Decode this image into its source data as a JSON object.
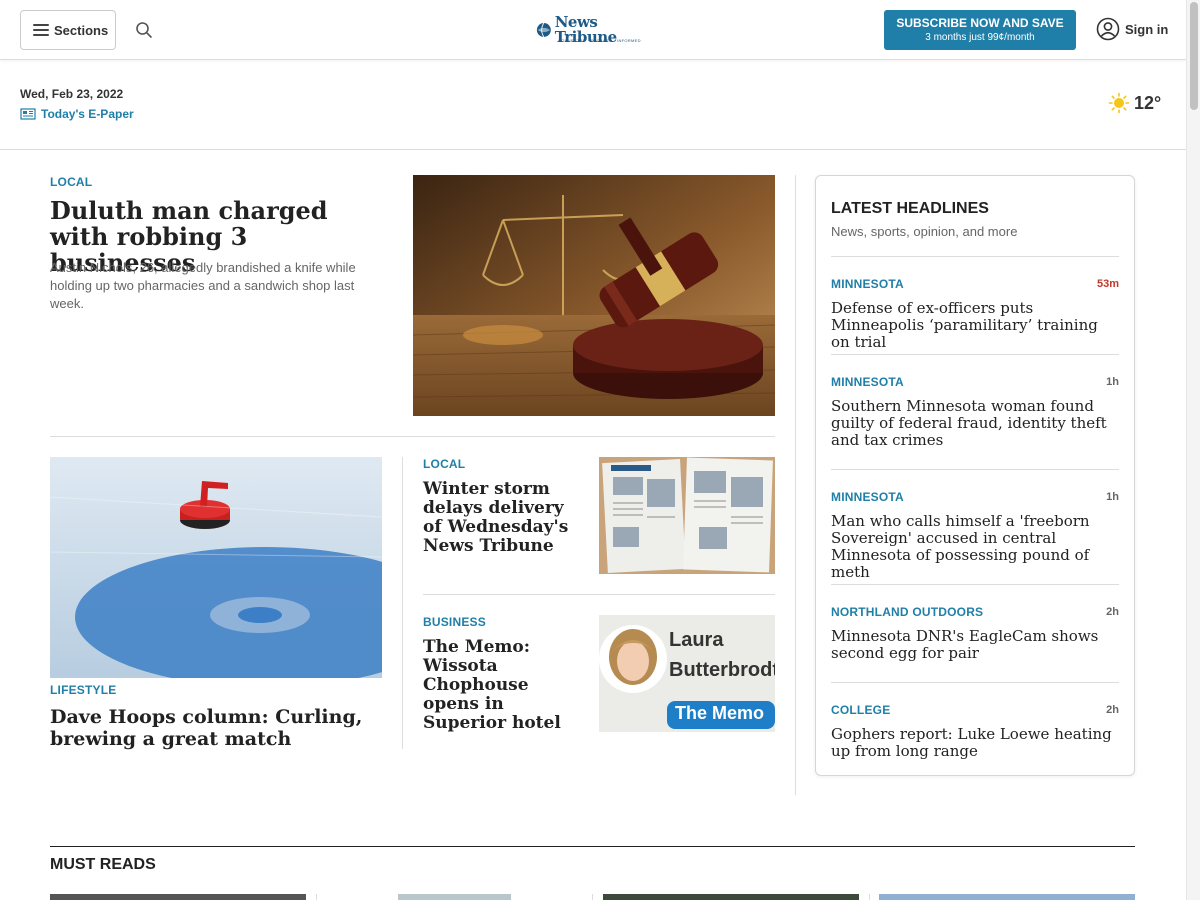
{
  "header": {
    "sections_label": "Sections",
    "logo_text": "News Tribune",
    "logo_tagline": "CONNECTED · ENGAGED · INFORMED",
    "subscribe_line1": "SUBSCRIBE NOW AND SAVE",
    "subscribe_line2": "3 months just 99¢/month",
    "signin_label": "Sign in",
    "accent_color": "#1f7fa8"
  },
  "datebar": {
    "date": "Wed, Feb 23, 2022",
    "epaper_label": "Today's E-Paper",
    "temperature": "12°",
    "weather_icon": "sun-icon"
  },
  "lead_story": {
    "kicker": "LOCAL",
    "title": "Duluth man charged with robbing 3 businesses",
    "summary": "Austin Nichols, 26, allegedly brandished a knife while holding up two pharmacies and a sandwich shop last week."
  },
  "curling_story": {
    "kicker": "LIFESTYLE",
    "title": "Dave Hoops column: Curling, brewing a great match"
  },
  "side_stories": [
    {
      "kicker": "LOCAL",
      "title": "Winter storm delays delivery of Wednesday's News Tribune"
    },
    {
      "kicker": "BUSINESS",
      "title": "The Memo: Wissota Chophouse opens in Superior hotel",
      "image_text_1": "Laura",
      "image_text_2": "Butterbrodt",
      "image_badge": "The Memo"
    }
  ],
  "latest": {
    "heading": "LATEST HEADLINES",
    "subheading": "News, sports, opinion, and more",
    "items": [
      {
        "kicker": "MINNESOTA",
        "time": "53m",
        "title": "Defense of ex-officers puts Minneapolis ‘paramilitary’ training on trial"
      },
      {
        "kicker": "MINNESOTA",
        "time": "1h",
        "title": "Southern Minnesota woman found guilty of federal fraud, identity theft and tax crimes"
      },
      {
        "kicker": "MINNESOTA",
        "time": "1h",
        "title": "Man who calls himself a 'freeborn Sovereign' accused in central Minnesota of possessing pound of meth"
      },
      {
        "kicker": "NORTHLAND OUTDOORS",
        "time": "2h",
        "title": "Minnesota DNR's EagleCam shows second egg for pair"
      },
      {
        "kicker": "COLLEGE",
        "time": "2h",
        "title": "Gophers report: Luke Loewe heating up from long range"
      }
    ]
  },
  "must_reads": {
    "heading": "MUST READS"
  }
}
